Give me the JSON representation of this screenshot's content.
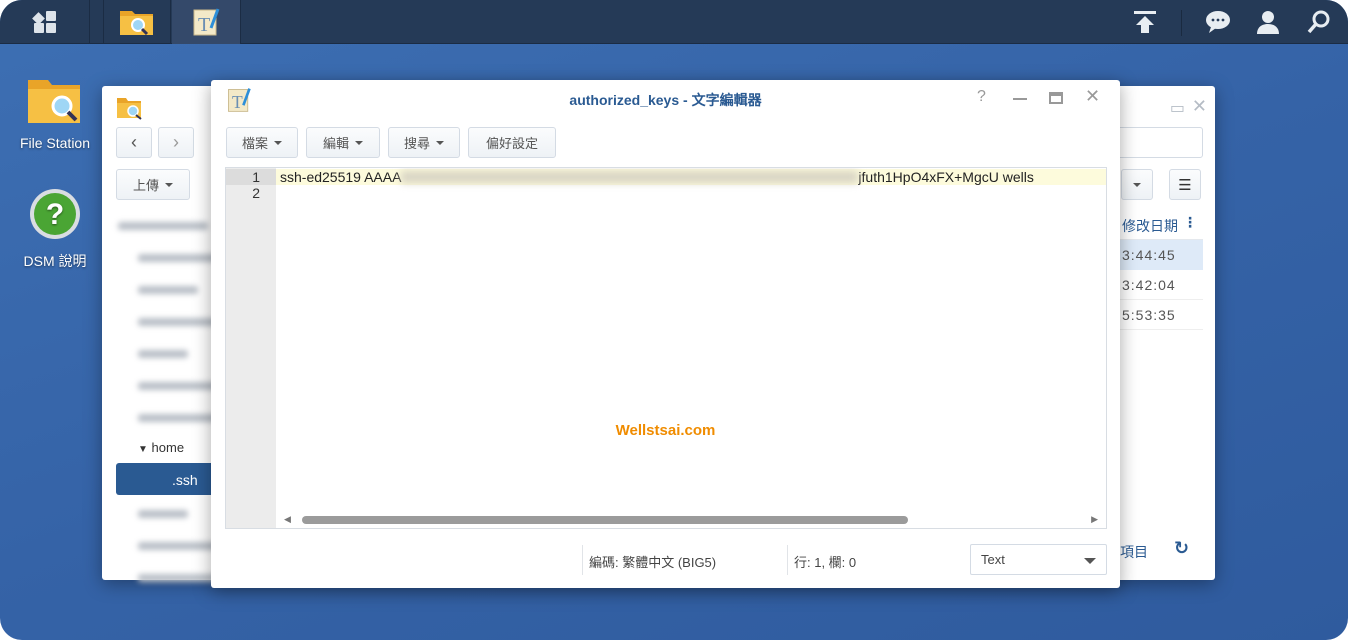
{
  "taskbar": {
    "icons": [
      "apps-grid-icon",
      "file-station-icon",
      "text-editor-icon"
    ],
    "tray": [
      "upload-icon",
      "chat-icon",
      "user-icon",
      "search-icon"
    ]
  },
  "desktop": {
    "items": [
      {
        "label": "File Station",
        "icon": "file-station-icon"
      },
      {
        "label": "DSM 說明",
        "icon": "help-icon"
      }
    ]
  },
  "file_station": {
    "upload_label": "上傳",
    "tree": {
      "home": "home",
      "selected": ".ssh"
    },
    "column_modified": "修改日期",
    "rows": [
      "3:44:45",
      "3:42:04",
      "5:53:35"
    ],
    "footer_items": "項目"
  },
  "editor": {
    "title": "authorized_keys - 文字編輯器",
    "menu": [
      {
        "label": "檔案"
      },
      {
        "label": "編輯"
      },
      {
        "label": "搜尋"
      },
      {
        "label": "偏好設定"
      }
    ],
    "lines": [
      {
        "num": "1",
        "start": "ssh-ed25519 AAAA",
        "end": "jfuth1HpO4xFX+MgcU wells"
      },
      {
        "num": "2",
        "start": "",
        "end": ""
      }
    ],
    "status": {
      "encoding": "編碼: 繁體中文 (BIG5)",
      "position": "行: 1, 欄: 0",
      "mode": "Text"
    },
    "watermark": "Wellstsai.com"
  },
  "colors": {
    "accent": "#2a5a92",
    "watermark": "#f08c00",
    "line_highlight": "#fdfbdc"
  }
}
